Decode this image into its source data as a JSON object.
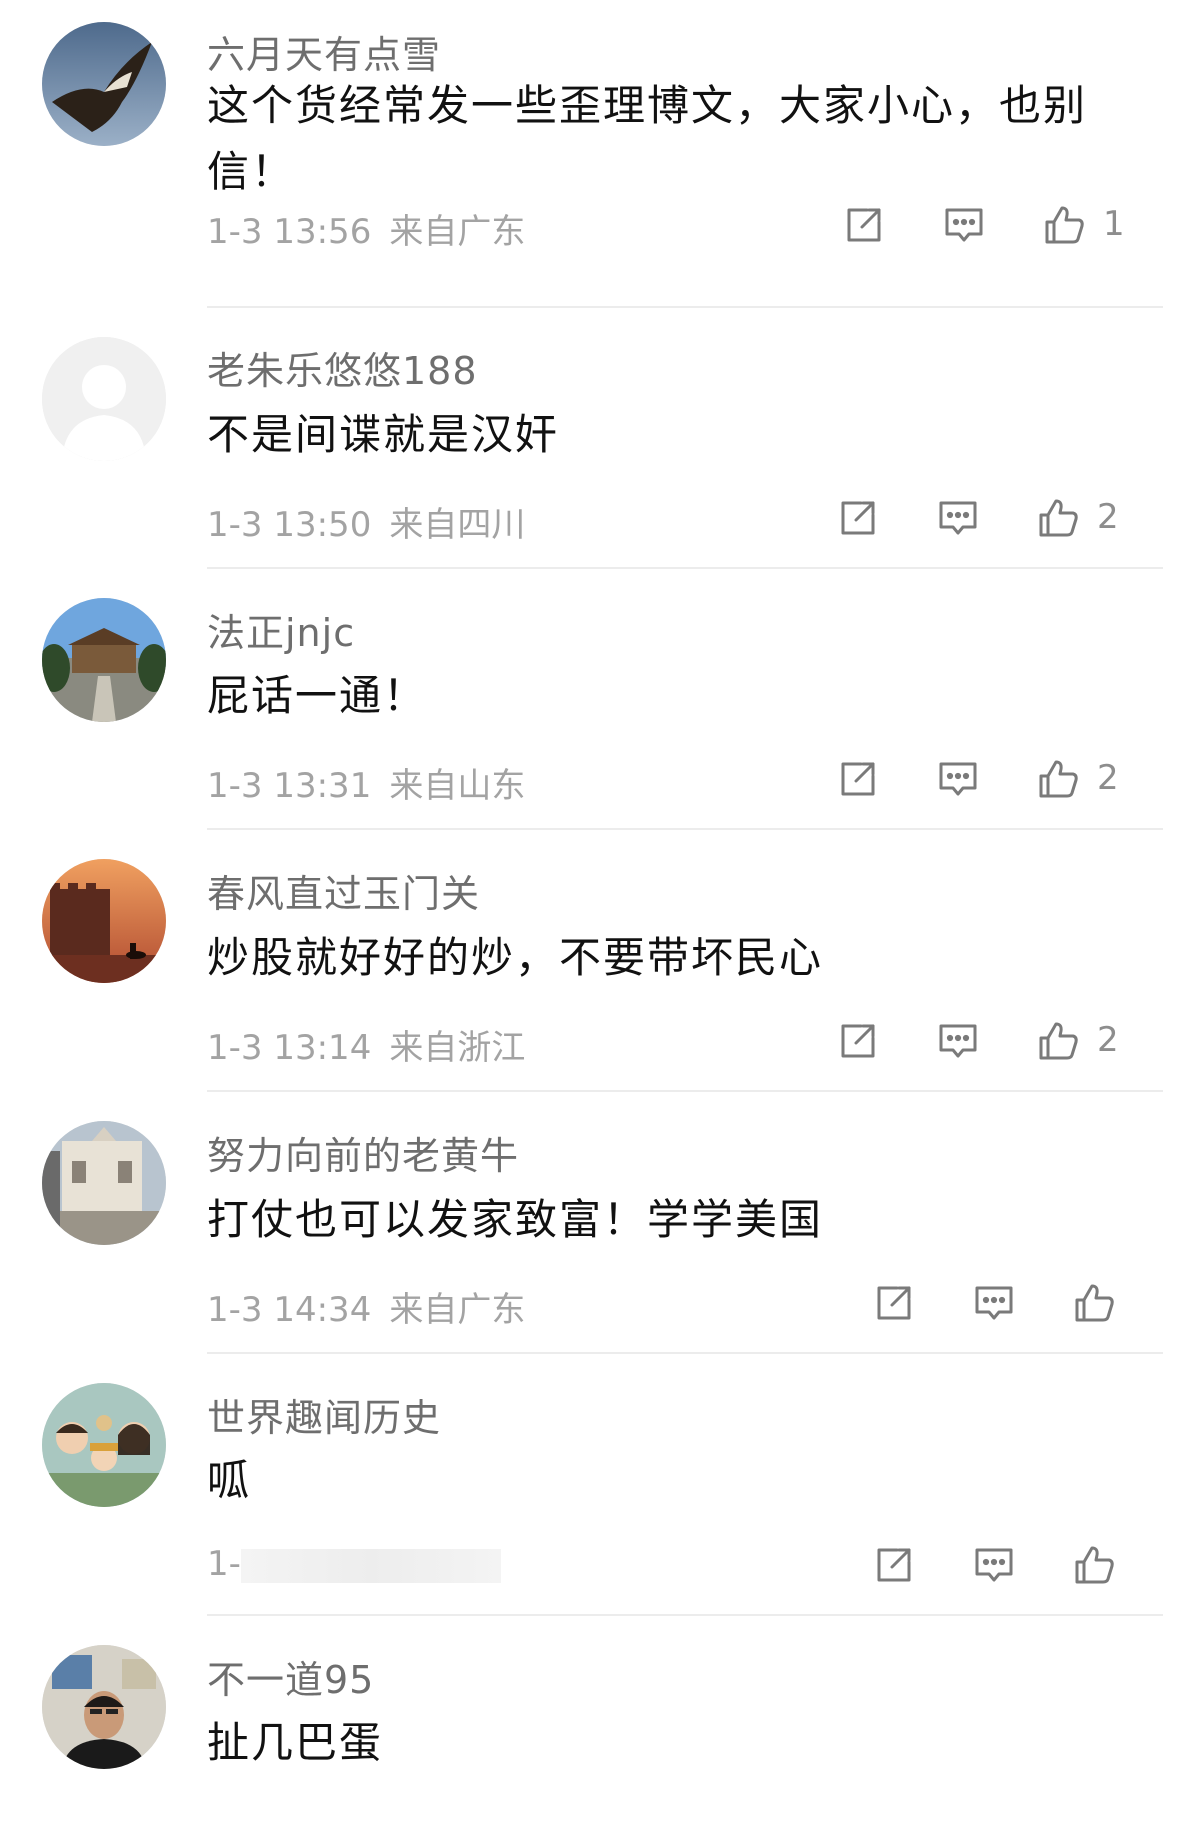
{
  "comments": [
    {
      "username": "六月天有点雪",
      "content": "这个货经常发一些歪理博文，大家小心，也别信！",
      "time": "1-3 13:56",
      "location": "来自广东",
      "likes": "1",
      "avatar": "eagle"
    },
    {
      "username": "老朱乐悠悠188",
      "content": "不是间谍就是汉奸",
      "time": "1-3 13:50",
      "location": "来自四川",
      "likes": "2",
      "avatar": "default-person"
    },
    {
      "username": "法正jnjc",
      "content": "屁话一通！",
      "time": "1-3 13:31",
      "location": "来自山东",
      "likes": "2",
      "avatar": "campus-building"
    },
    {
      "username": "春风直过玉门关",
      "content": "炒股就好好的炒，不要带坏民心",
      "time": "1-3 13:14",
      "location": "来自浙江",
      "likes": "2",
      "avatar": "desert-fortress"
    },
    {
      "username": "努力向前的老黄牛",
      "content": "打仗也可以发家致富！学学美国",
      "time": "1-3 14:34",
      "location": "来自广东",
      "likes": "",
      "avatar": "european-street"
    },
    {
      "username": "世界趣闻历史",
      "content": "呱",
      "time": "1-",
      "location": "",
      "likes": "",
      "avatar": "cartoon-family"
    },
    {
      "username": "不一道95",
      "content": "扯几巴蛋",
      "time": "",
      "location": "",
      "likes": "",
      "avatar": "man-portrait"
    }
  ],
  "icons": {
    "share": "share-icon",
    "reply": "comment-icon",
    "like": "thumbs-up-icon"
  },
  "colors": {
    "username": "#6e6e6e",
    "meta": "#a3a3a3",
    "text": "#111111",
    "divider": "#ececec"
  }
}
